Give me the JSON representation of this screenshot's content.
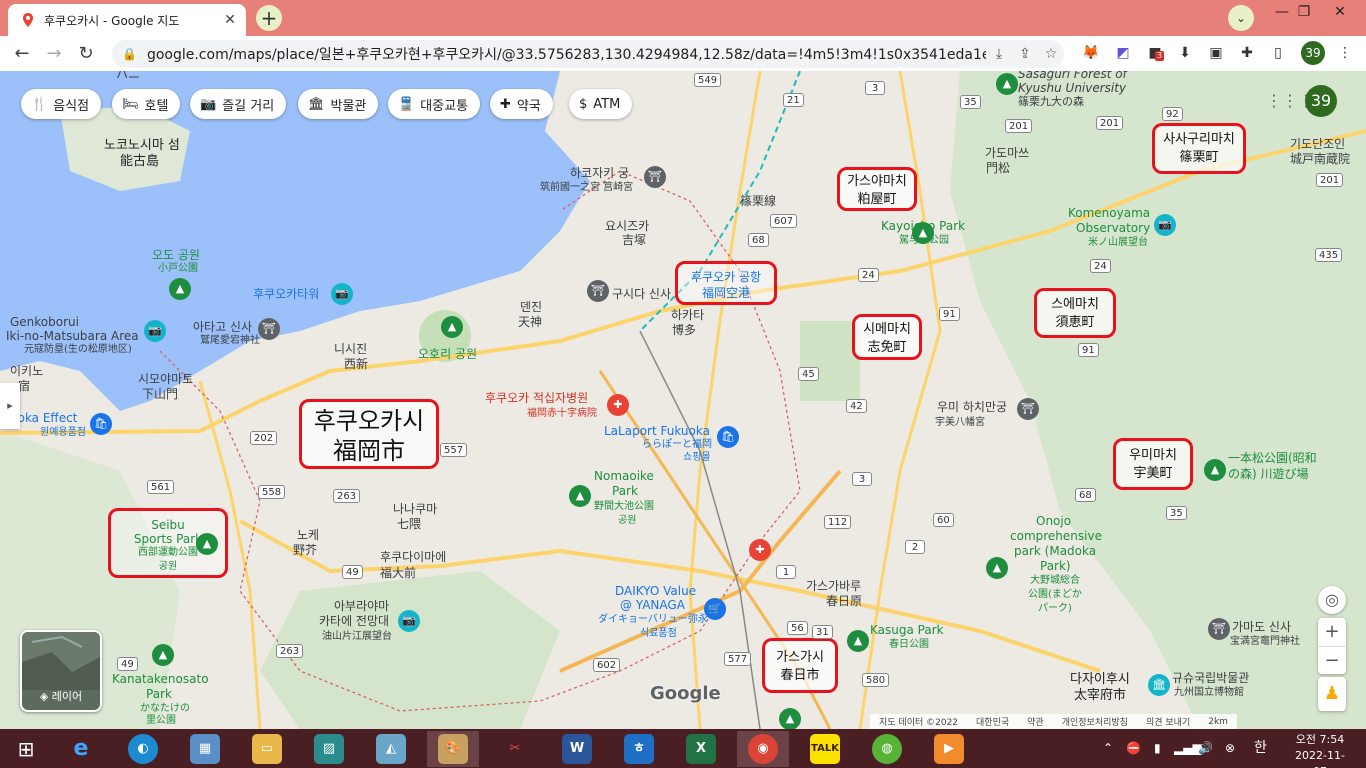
{
  "browser": {
    "tab_title": "후쿠오카시 - Google 지도",
    "tab_close": "✕",
    "new_tab": "+",
    "url": "google.com/maps/place/일본+후쿠오카현+후쿠오카시/@33.5756283,130.4294984,12.58z/data=!4m5!3m4!1s0x3541eda1e984842...",
    "profile_initials": "39",
    "extension_badge": "3"
  },
  "map": {
    "chips": [
      {
        "icon": "🍴",
        "label": "음식점"
      },
      {
        "icon": "🛏",
        "label": "호텔"
      },
      {
        "icon": "📷",
        "label": "즐길 거리"
      },
      {
        "icon": "🏛",
        "label": "박물관"
      },
      {
        "icon": "🚆",
        "label": "대중교통"
      },
      {
        "icon": "✚",
        "label": "약국"
      },
      {
        "icon": "$",
        "label": "ATM"
      }
    ],
    "profile_initials": "39",
    "layer_label": "레이어",
    "google_logo": "Google",
    "footer": {
      "data": "지도 데이터 ©2022",
      "country": "대한민국",
      "terms": "약관",
      "privacy": "개인정보처리방침",
      "feedback": "의견 보내기",
      "scale": "2km"
    },
    "highlight_boxes": [
      {
        "line1": "사사구리마치",
        "line2": "篠栗町"
      },
      {
        "line1": "가스야마치",
        "line2": "粕屋町"
      },
      {
        "line1": "후쿠오카 공항",
        "line2": "福岡空港"
      },
      {
        "line1": "스에마치",
        "line2": "須恵町"
      },
      {
        "line1": "시메마치",
        "line2": "志免町"
      },
      {
        "line1": "후쿠오카시",
        "line2": "福岡市"
      },
      {
        "line1": "우미마치",
        "line2": "宇美町"
      },
      {
        "line1": "Seibu",
        "line2": "Sports Park",
        "line3": "西部運動公園",
        "line4": "공원"
      },
      {
        "line1": "가스가시",
        "line2": "春日市"
      }
    ],
    "labels": {
      "nokonoshima": "노코노시마 섬",
      "nokonoshima_jp": "能古島",
      "odo_park": "오도 공원",
      "odo_park_jp": "小戸公園",
      "fukuoka_tower": "후쿠오카타워",
      "genkoborui": "Genkoborui",
      "ikinomatsubara": "Iki-no-Matsubara Area",
      "ikinomatsubara_jp": "元寇防塁(生の松原地区)",
      "atago": "아타고 신사",
      "atago_jp": "鷲尾愛宕神社",
      "nishijin": "니시진",
      "nishijin_jp": "西新",
      "ohori": "오호리 공원",
      "tenjin": "덴진",
      "tenjin_jp": "天神",
      "kushida": "구시다 신사",
      "hakata": "하카타",
      "hakata_jp": "博多",
      "hakozaki": "하코자키 궁",
      "hakozaki_jp": "筑前國一之宮 筥崎宮",
      "yoshizuka": "요시즈카",
      "yoshizuka_jp": "吉塚",
      "sasaguri_forest": "Sasaguri Forest of",
      "kyushu_univ": "Kyushu University",
      "kyushu_univ_jp": "篠栗九大の森",
      "kadomatsu": "가도마쓰",
      "kadomatsu_jp": "門松",
      "sasaguri_line": "篠栗線",
      "kayoicho": "Kayoicho Park",
      "kayoicho_jp": "駕与丁公园",
      "komenoyama": "Komenoyama",
      "komenoyama2": "Observatory",
      "komenoyama_jp": "米ノ山展望台",
      "kitodan": "기도단조인",
      "kitodan_jp": "城戸南蔵院",
      "redcross": "후쿠오카 적십자병원",
      "redcross_jp": "福岡赤十字病院",
      "laport": "LaLaport Fukuoka",
      "laport_jp": "ららぽーと福岡",
      "laport_kr": "쇼핑몰",
      "umi_hachiman": "우미 하치만궁",
      "umi_hachiman_jp": "宇美八幡宮",
      "nomaoike": "Nomaoike",
      "nomaoike2": "Park",
      "nomaoike_jp": "野間大池公園",
      "park_kr": "공원",
      "nanakuma": "나나쿠마",
      "nanakuma_jp": "七隈",
      "noke": "노케",
      "noke_jp": "野芥",
      "fukudaimae": "후쿠다이마에",
      "fukudaimae_jp": "福大前",
      "aburayama": "아부라야마",
      "aburayama2": "카타에 전망대",
      "aburayama_jp": "油山片江展望台",
      "daikyo": "DAIKYO Value",
      "daikyo2": "@ YANAGA",
      "daikyo_jp": "ダイキョーバリュー弥永",
      "daikyo_kr": "식료품점",
      "kasugabaru": "가스가바루",
      "kasugabaru_jp": "春日原",
      "kasuga_park": "Kasuga Park",
      "kasuga_park_jp": "春日公園",
      "onojo": "Onojo",
      "onojo2": "comprehensive",
      "onojo3": "park (Madoka",
      "onojo4": "Park)",
      "onojo_jp": "大野城総合",
      "onojo_jp2": "公園(まどか",
      "onojo_jp3": "パーク)",
      "ippon": "一本松公園(昭和",
      "ippon2": "の森) 川遊び場",
      "kamado": "가마도 신사",
      "kamado_jp": "宝満宮竈門神社",
      "kyushu_museum": "규슈국립박물관",
      "kyushu_museum_jp": "九州国立博物館",
      "dazaifu": "다자이후시",
      "dazaifu_jp": "太宰府市",
      "kanatake": "Kanatakenosato",
      "kanatake2": "Park",
      "kanatake_jp": "かなたけの",
      "kanatake_jp2": "里公園",
      "shimoyamato": "시모야마토",
      "shimoyamato_jp": "下山門",
      "iki": "이키노",
      "iki2": "宿",
      "fukuoka_effect": "uoka Effect",
      "fukuoka_effect2": "원예용품점",
      "hanes": "ハニ"
    },
    "road_numbers": [
      "549",
      "21",
      "3",
      "35",
      "201",
      "607",
      "68",
      "24",
      "91",
      "45",
      "42",
      "202",
      "557",
      "263",
      "561",
      "558",
      "49",
      "263",
      "602",
      "577",
      "56",
      "31",
      "580",
      "112",
      "60",
      "2",
      "68",
      "35",
      "3",
      "1",
      "91",
      "24",
      "49",
      "201",
      "92",
      "435",
      "201"
    ]
  },
  "taskbar": {
    "clock_time": "오전 7:54",
    "clock_date": "2022-11-07",
    "ime": "한"
  },
  "colors": {
    "tab_bar": "#e8807a",
    "taskbar": "#4a1f24",
    "highlight": "#e8131a",
    "water": "#9cc0f9",
    "road": "#fdd36b"
  }
}
